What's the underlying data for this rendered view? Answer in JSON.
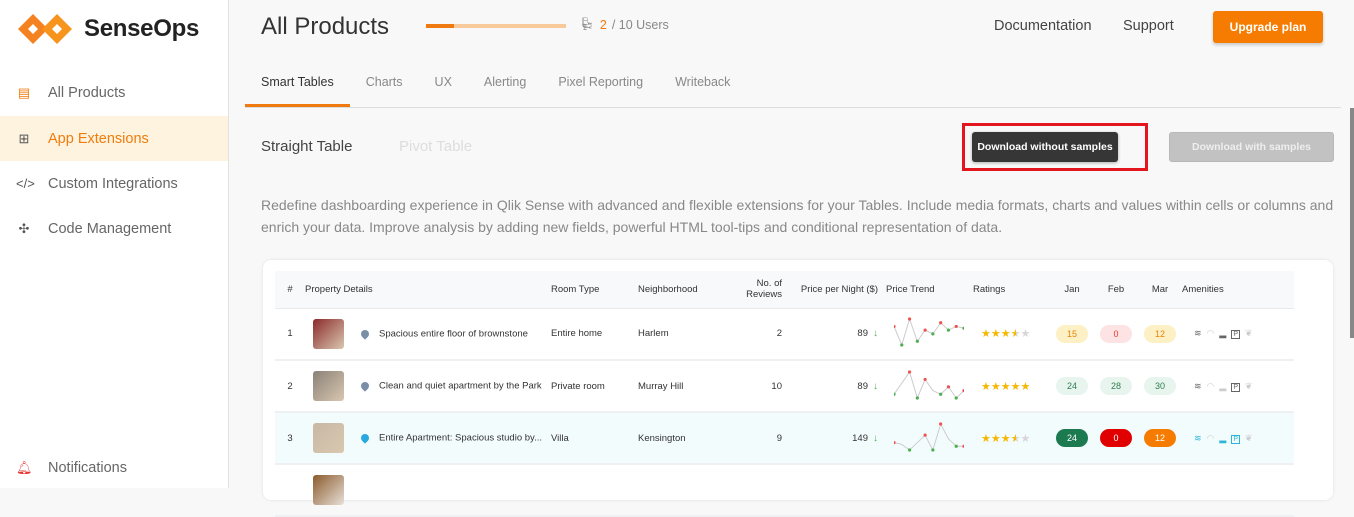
{
  "brand": {
    "name": "SenseOps",
    "accent": "#f07c0c"
  },
  "sidebar": {
    "items": [
      {
        "label": "All Products",
        "icon": "archive-icon"
      },
      {
        "label": "App Extensions",
        "icon": "grid-plus-icon"
      },
      {
        "label": "Custom Integrations",
        "icon": "code-icon"
      },
      {
        "label": "Code Management",
        "icon": "nodes-icon"
      }
    ],
    "bottom": {
      "label": "Notifications",
      "icon": "bell-icon"
    }
  },
  "header": {
    "title": "All Products",
    "users_used": "2",
    "users_total": "/ 10 Users",
    "users_progress": 0.2,
    "links": [
      "Documentation",
      "Support"
    ],
    "upgrade": "Upgrade plan"
  },
  "tabs": [
    "Smart Tables",
    "Charts",
    "UX",
    "Alerting",
    "Pixel Reporting",
    "Writeback"
  ],
  "subtabs": [
    "Straight Table",
    "Pivot Table"
  ],
  "buttons": {
    "download_without": "Download without samples",
    "download_with": "Download with samples"
  },
  "description": "Redefine dashboarding experience in Qlik Sense with advanced and flexible extensions for your Tables. Include media formats, charts and values within cells or columns and enrich your data. Improve analysis by adding new fields, powerful HTML tool-tips and conditional representation of data.",
  "table": {
    "columns": [
      "#",
      "Property Details",
      "Room Type",
      "Neighborhood",
      "No. of Reviews",
      "Price per Night ($)",
      "Price Trend",
      "Ratings",
      "Jan",
      "Feb",
      "Mar",
      "Amenities"
    ],
    "rows": [
      {
        "n": "1",
        "name": "Spacious entire floor of brownstone",
        "room": "Entire home",
        "hood": "Harlem",
        "reviews": "2",
        "price": "89",
        "rating": 3.5,
        "trend": [
          6,
          1,
          8,
          2,
          5,
          4,
          7,
          5,
          6,
          5.5
        ],
        "jan": "15",
        "feb": "0",
        "mar": "12",
        "pills": [
          "#fdf0c4:#e8830c",
          "#fde3e3:#e53935",
          "#fdf0c4:#e8830c"
        ],
        "thumb": "#8b2a2a",
        "hl": false
      },
      {
        "n": "2",
        "name": "Clean and quiet apartment by the Park",
        "room": "Private room",
        "hood": "Murray Hill",
        "reviews": "10",
        "price": "89",
        "rating": 5,
        "trend": [
          2,
          5,
          8,
          1,
          6,
          3,
          2,
          4,
          1,
          3
        ],
        "jan": "24",
        "feb": "28",
        "mar": "30",
        "pills": [
          "#e8f5ee:#2e7d4f",
          "#e8f5ee:#2e7d4f",
          "#e8f5ee:#2e7d4f"
        ],
        "thumb": "#8a8178",
        "hl": false
      },
      {
        "n": "3",
        "name": "Entire Apartment: Spacious studio by...",
        "room": "Villa",
        "hood": "Kensington",
        "reviews": "9",
        "price": "149",
        "rating": 3.5,
        "trend": [
          3,
          2.5,
          1,
          3,
          5,
          1,
          8,
          4,
          2,
          2
        ],
        "jan": "24",
        "feb": "0",
        "mar": "12",
        "pills": [
          "#1b7a50:#ffffff",
          "#e00000:#ffffff",
          "#f57c00:#ffffff"
        ],
        "thumb": "#c8b8a4",
        "hl": true
      }
    ]
  }
}
